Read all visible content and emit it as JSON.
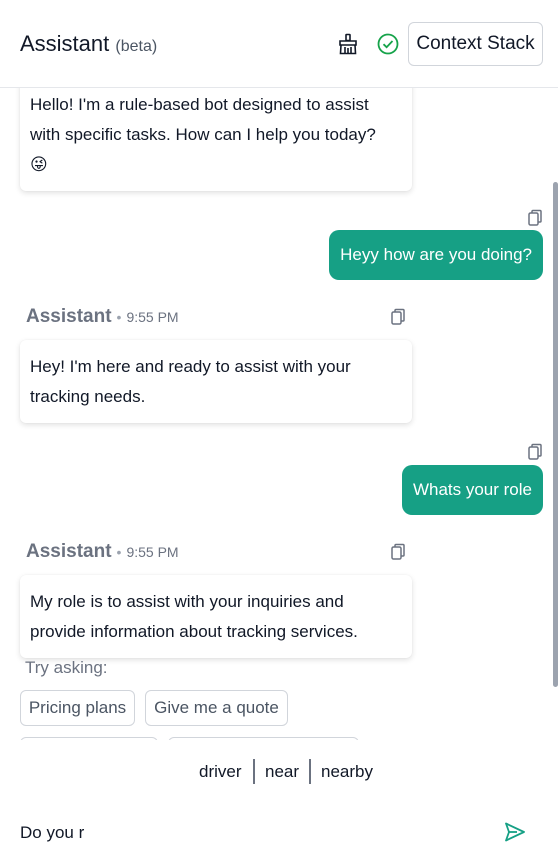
{
  "header": {
    "title": "Assistant",
    "beta": "(beta)",
    "context_button": "Context Stack"
  },
  "messages": [
    {
      "role": "assistant",
      "text": "Hello! I'm a rule-based bot designed to assist with specific tasks. How can I help you today?",
      "emoji": "😜"
    },
    {
      "role": "user",
      "text": "Heyy how are you doing?"
    },
    {
      "role": "assistant",
      "name": "Assistant",
      "time": "9:55 PM",
      "text": "Hey! I'm here and ready to assist with your tracking needs."
    },
    {
      "role": "user",
      "text": "Whats your role"
    },
    {
      "role": "assistant",
      "name": "Assistant",
      "time": "9:55 PM",
      "text": "My role is to assist with your inquiries and provide information about tracking services."
    }
  ],
  "try_asking": {
    "label": "Try asking:",
    "chips": [
      "Pricing plans",
      "Give me a quote"
    ]
  },
  "suggestions": [
    "driver",
    "near",
    "nearby"
  ],
  "input": {
    "value": "Do you r",
    "placeholder": ""
  },
  "colors": {
    "user_bubble": "#16a085",
    "check_icon": "#16a34a",
    "send_icon": "#16a085"
  },
  "icons": {
    "clear": "broom-icon",
    "status": "check-circle-icon",
    "copy": "copy-icon",
    "send": "send-icon"
  }
}
